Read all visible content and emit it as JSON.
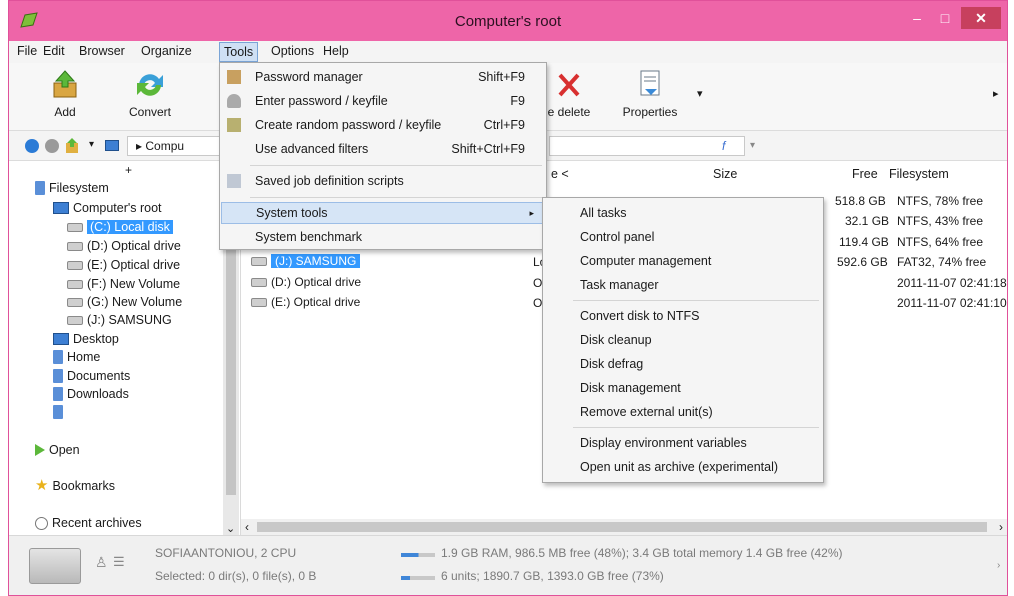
{
  "window": {
    "title": "Computer's root",
    "colors": {
      "titlebar": "#ee65a8",
      "close": "#c7405e",
      "selection": "#3399ff"
    }
  },
  "titlebar_buttons": {
    "minimize": "–",
    "maximize": "□",
    "close": "✕"
  },
  "menubar": [
    "File",
    "Edit",
    "Browser",
    "Organize",
    "Tools",
    "Options",
    "Help"
  ],
  "toolbar": {
    "add": "Add",
    "convert": "Convert",
    "secure_delete": "e delete",
    "properties": "Properties",
    "dropdown": "▾",
    "more": "▸"
  },
  "addressbar": {
    "path_prefix": "▸ Compu",
    "search_icon": "f",
    "search_dropdown": "▾"
  },
  "tree": {
    "expand_glyph": "+",
    "filesystem": "Filesystem",
    "computers_root": "Computer's root",
    "drives": [
      "(C:) Local disk",
      "(D:) Optical drive",
      "(E:) Optical drive",
      "(F:) New Volume",
      "(G:) New Volume",
      "(J:) SAMSUNG"
    ],
    "places": [
      "Desktop",
      "Home",
      "Documents",
      "Downloads",
      ""
    ],
    "open": "Open",
    "bookmarks": "Bookmarks",
    "recent_archives": "Recent archives"
  },
  "listing": {
    "col_name_partial": "e <",
    "col_size": "Size",
    "col_free": "Free",
    "col_filesystem": "Filesystem",
    "rows": [
      {
        "name": "",
        "type": "",
        "free": "518.8 GB",
        "fs": "NTFS, 78% free"
      },
      {
        "name": "",
        "type": "",
        "free": "32.1 GB",
        "fs": "NTFS, 43% free"
      },
      {
        "name": "",
        "type": "",
        "free": "119.4 GB",
        "fs": "NTFS, 64% free"
      },
      {
        "name": "(J:) SAMSUNG",
        "type": "Lo",
        "free": "592.6 GB",
        "fs": "FAT32, 74% free"
      },
      {
        "name": "(D:) Optical drive",
        "type": "Op",
        "free": "",
        "fs": "2011-11-07 02:41:18"
      },
      {
        "name": "(E:) Optical drive",
        "type": "Op",
        "free": "",
        "fs": "2011-11-07 02:41:10"
      }
    ]
  },
  "tools_menu": {
    "items": [
      {
        "label": "Password manager",
        "shortcut": "Shift+F9"
      },
      {
        "label": "Enter password / keyfile",
        "shortcut": "F9"
      },
      {
        "label": "Create random password / keyfile",
        "shortcut": "Ctrl+F9"
      },
      {
        "label": "Use advanced filters",
        "shortcut": "Shift+Ctrl+F9"
      },
      {
        "label": "Saved job definition scripts",
        "shortcut": ""
      },
      {
        "label": "System tools",
        "shortcut": "▸"
      },
      {
        "label": "System benchmark",
        "shortcut": ""
      }
    ]
  },
  "system_tools_menu": {
    "items": [
      "All tasks",
      "Control panel",
      "Computer management",
      "Task manager",
      "Convert disk to NTFS",
      "Disk cleanup",
      "Disk defrag",
      "Disk management",
      "Remove external unit(s)",
      "Display environment variables",
      "Open unit as archive (experimental)"
    ]
  },
  "status": {
    "machine": "SOFIAANTONIOU, 2 CPU",
    "selected": "Selected: 0 dir(s), 0 file(s), 0 B",
    "memory": "1.9 GB RAM, 986.5 MB free (48%); 3.4 GB total memory 1.4 GB free (42%)",
    "units": "6 units; 1890.7 GB, 1393.0 GB free (73%)",
    "memory_used_fraction": 0.52,
    "disk_used_fraction": 0.27
  },
  "scroll": {
    "left": "‹",
    "right": "›",
    "down": "⌄"
  }
}
